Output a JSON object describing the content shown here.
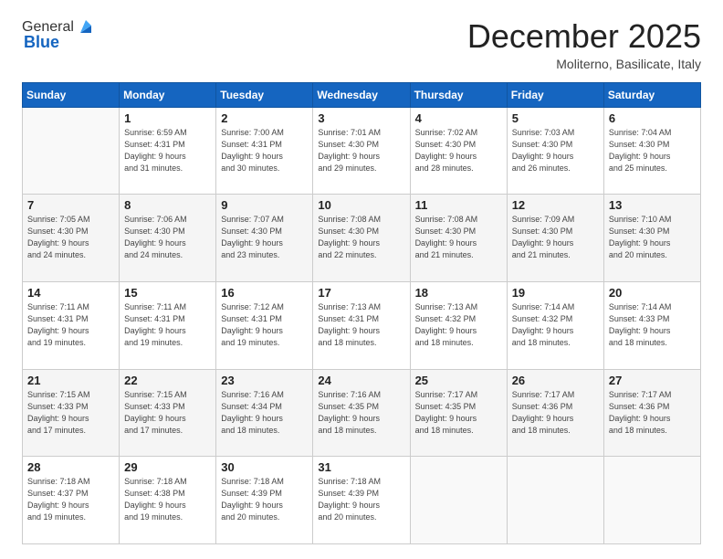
{
  "header": {
    "logo_general": "General",
    "logo_blue": "Blue",
    "month_title": "December 2025",
    "location": "Moliterno, Basilicate, Italy"
  },
  "days_of_week": [
    "Sunday",
    "Monday",
    "Tuesday",
    "Wednesday",
    "Thursday",
    "Friday",
    "Saturday"
  ],
  "weeks": [
    [
      {
        "day": "",
        "info": ""
      },
      {
        "day": "1",
        "info": "Sunrise: 6:59 AM\nSunset: 4:31 PM\nDaylight: 9 hours\nand 31 minutes."
      },
      {
        "day": "2",
        "info": "Sunrise: 7:00 AM\nSunset: 4:31 PM\nDaylight: 9 hours\nand 30 minutes."
      },
      {
        "day": "3",
        "info": "Sunrise: 7:01 AM\nSunset: 4:30 PM\nDaylight: 9 hours\nand 29 minutes."
      },
      {
        "day": "4",
        "info": "Sunrise: 7:02 AM\nSunset: 4:30 PM\nDaylight: 9 hours\nand 28 minutes."
      },
      {
        "day": "5",
        "info": "Sunrise: 7:03 AM\nSunset: 4:30 PM\nDaylight: 9 hours\nand 26 minutes."
      },
      {
        "day": "6",
        "info": "Sunrise: 7:04 AM\nSunset: 4:30 PM\nDaylight: 9 hours\nand 25 minutes."
      }
    ],
    [
      {
        "day": "7",
        "info": "Sunrise: 7:05 AM\nSunset: 4:30 PM\nDaylight: 9 hours\nand 24 minutes."
      },
      {
        "day": "8",
        "info": "Sunrise: 7:06 AM\nSunset: 4:30 PM\nDaylight: 9 hours\nand 24 minutes."
      },
      {
        "day": "9",
        "info": "Sunrise: 7:07 AM\nSunset: 4:30 PM\nDaylight: 9 hours\nand 23 minutes."
      },
      {
        "day": "10",
        "info": "Sunrise: 7:08 AM\nSunset: 4:30 PM\nDaylight: 9 hours\nand 22 minutes."
      },
      {
        "day": "11",
        "info": "Sunrise: 7:08 AM\nSunset: 4:30 PM\nDaylight: 9 hours\nand 21 minutes."
      },
      {
        "day": "12",
        "info": "Sunrise: 7:09 AM\nSunset: 4:30 PM\nDaylight: 9 hours\nand 21 minutes."
      },
      {
        "day": "13",
        "info": "Sunrise: 7:10 AM\nSunset: 4:30 PM\nDaylight: 9 hours\nand 20 minutes."
      }
    ],
    [
      {
        "day": "14",
        "info": "Sunrise: 7:11 AM\nSunset: 4:31 PM\nDaylight: 9 hours\nand 19 minutes."
      },
      {
        "day": "15",
        "info": "Sunrise: 7:11 AM\nSunset: 4:31 PM\nDaylight: 9 hours\nand 19 minutes."
      },
      {
        "day": "16",
        "info": "Sunrise: 7:12 AM\nSunset: 4:31 PM\nDaylight: 9 hours\nand 19 minutes."
      },
      {
        "day": "17",
        "info": "Sunrise: 7:13 AM\nSunset: 4:31 PM\nDaylight: 9 hours\nand 18 minutes."
      },
      {
        "day": "18",
        "info": "Sunrise: 7:13 AM\nSunset: 4:32 PM\nDaylight: 9 hours\nand 18 minutes."
      },
      {
        "day": "19",
        "info": "Sunrise: 7:14 AM\nSunset: 4:32 PM\nDaylight: 9 hours\nand 18 minutes."
      },
      {
        "day": "20",
        "info": "Sunrise: 7:14 AM\nSunset: 4:33 PM\nDaylight: 9 hours\nand 18 minutes."
      }
    ],
    [
      {
        "day": "21",
        "info": "Sunrise: 7:15 AM\nSunset: 4:33 PM\nDaylight: 9 hours\nand 17 minutes."
      },
      {
        "day": "22",
        "info": "Sunrise: 7:15 AM\nSunset: 4:33 PM\nDaylight: 9 hours\nand 17 minutes."
      },
      {
        "day": "23",
        "info": "Sunrise: 7:16 AM\nSunset: 4:34 PM\nDaylight: 9 hours\nand 18 minutes."
      },
      {
        "day": "24",
        "info": "Sunrise: 7:16 AM\nSunset: 4:35 PM\nDaylight: 9 hours\nand 18 minutes."
      },
      {
        "day": "25",
        "info": "Sunrise: 7:17 AM\nSunset: 4:35 PM\nDaylight: 9 hours\nand 18 minutes."
      },
      {
        "day": "26",
        "info": "Sunrise: 7:17 AM\nSunset: 4:36 PM\nDaylight: 9 hours\nand 18 minutes."
      },
      {
        "day": "27",
        "info": "Sunrise: 7:17 AM\nSunset: 4:36 PM\nDaylight: 9 hours\nand 18 minutes."
      }
    ],
    [
      {
        "day": "28",
        "info": "Sunrise: 7:18 AM\nSunset: 4:37 PM\nDaylight: 9 hours\nand 19 minutes."
      },
      {
        "day": "29",
        "info": "Sunrise: 7:18 AM\nSunset: 4:38 PM\nDaylight: 9 hours\nand 19 minutes."
      },
      {
        "day": "30",
        "info": "Sunrise: 7:18 AM\nSunset: 4:39 PM\nDaylight: 9 hours\nand 20 minutes."
      },
      {
        "day": "31",
        "info": "Sunrise: 7:18 AM\nSunset: 4:39 PM\nDaylight: 9 hours\nand 20 minutes."
      },
      {
        "day": "",
        "info": ""
      },
      {
        "day": "",
        "info": ""
      },
      {
        "day": "",
        "info": ""
      }
    ]
  ]
}
